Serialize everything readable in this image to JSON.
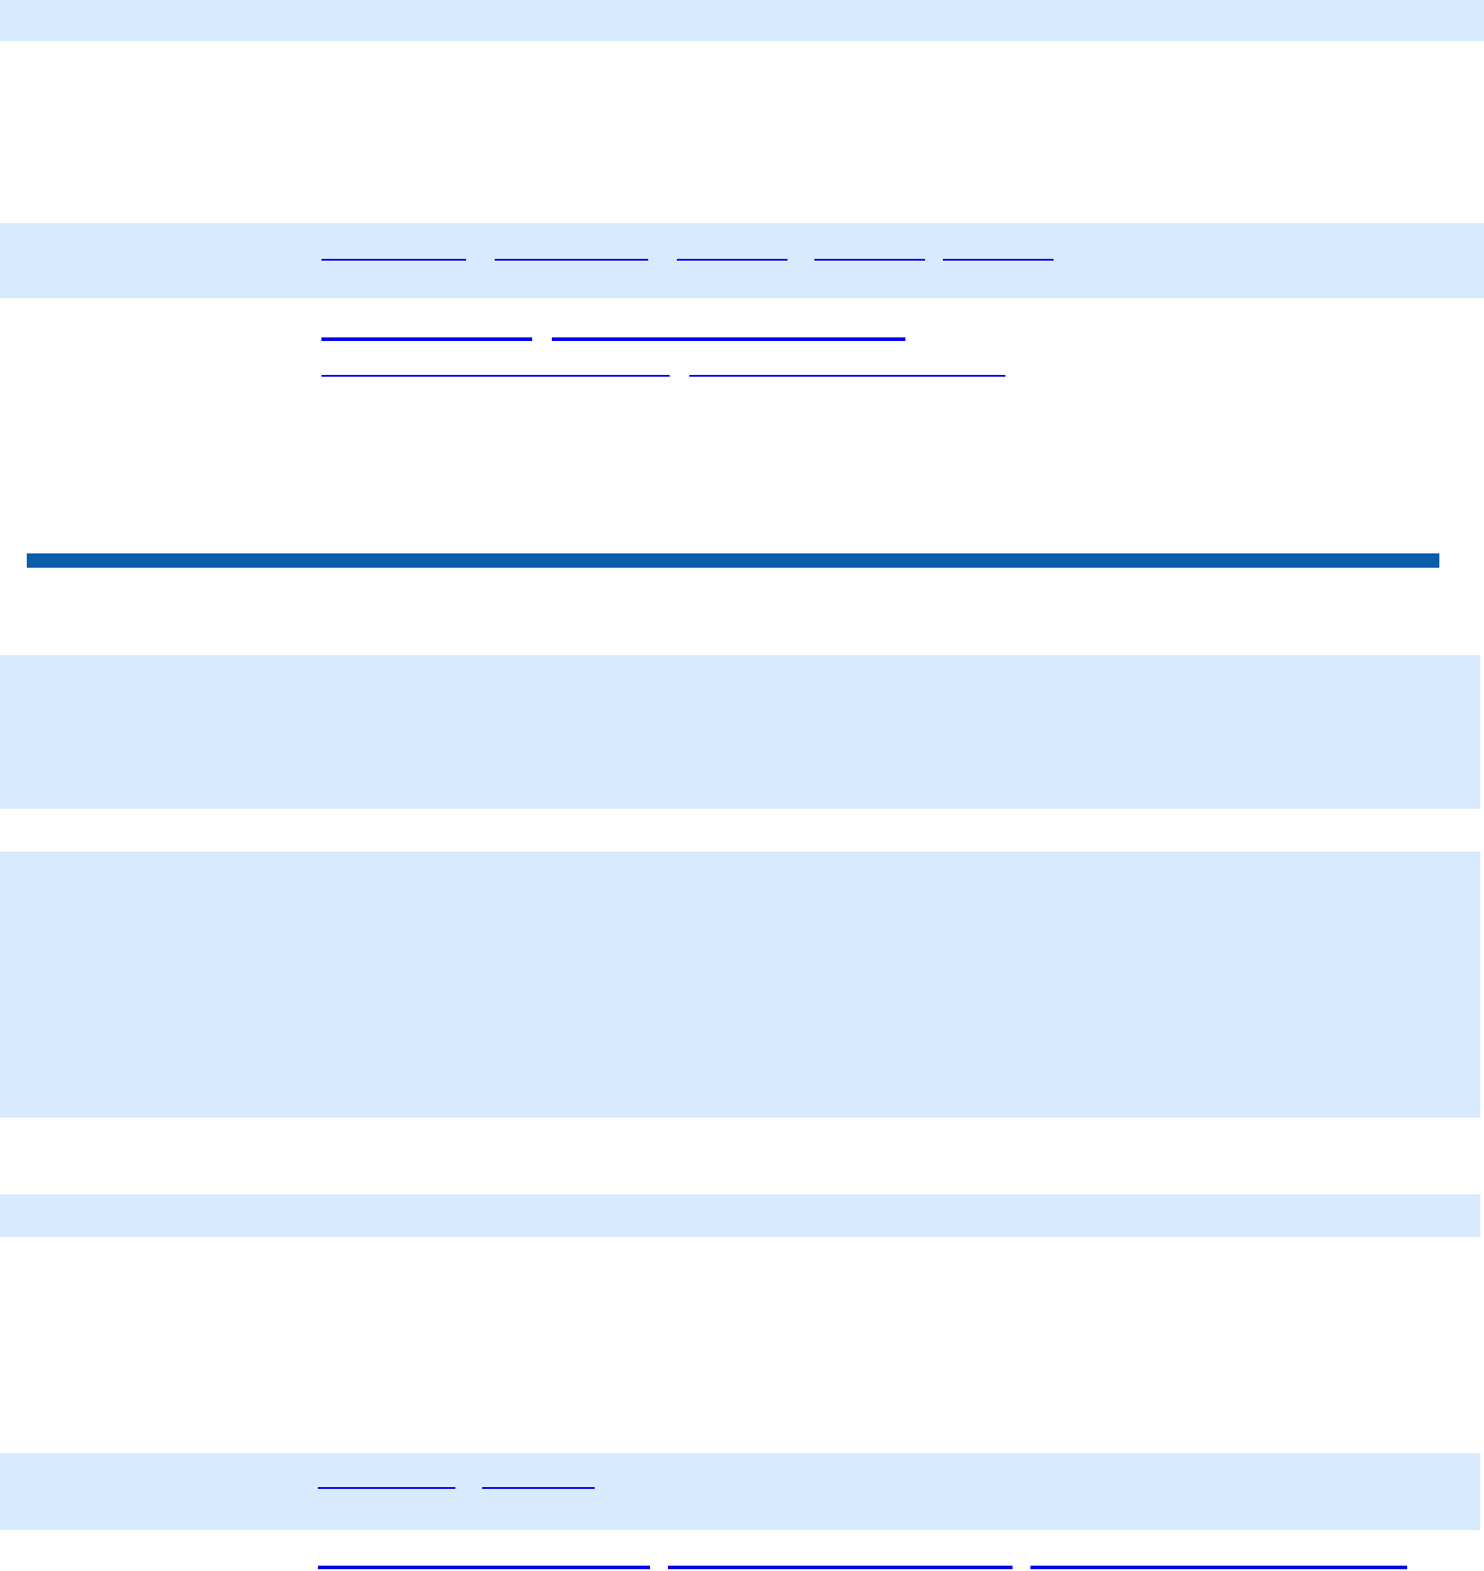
{
  "sections": [
    {
      "kind": "band"
    },
    {
      "kind": "band",
      "link_lines": [
        [
          {
            "kind": "thin"
          },
          {
            "kind": "thin"
          },
          {
            "kind": "thin"
          },
          {
            "kind": "thin"
          },
          {
            "kind": "thin"
          }
        ]
      ]
    },
    {
      "kind": "plain",
      "link_lines": [
        [
          {
            "kind": "thick"
          },
          {
            "kind": "thick"
          }
        ],
        [
          {
            "kind": "thin"
          },
          {
            "kind": "thin"
          }
        ]
      ]
    },
    {
      "kind": "rule"
    },
    {
      "kind": "band"
    },
    {
      "kind": "band"
    },
    {
      "kind": "band"
    },
    {
      "kind": "band",
      "link_lines": [
        [
          {
            "kind": "thin"
          },
          {
            "kind": "thin"
          }
        ]
      ]
    },
    {
      "kind": "plain",
      "link_lines": [
        [
          {
            "kind": "thick"
          },
          {
            "kind": "thick"
          },
          {
            "kind": "thick"
          }
        ]
      ]
    }
  ]
}
